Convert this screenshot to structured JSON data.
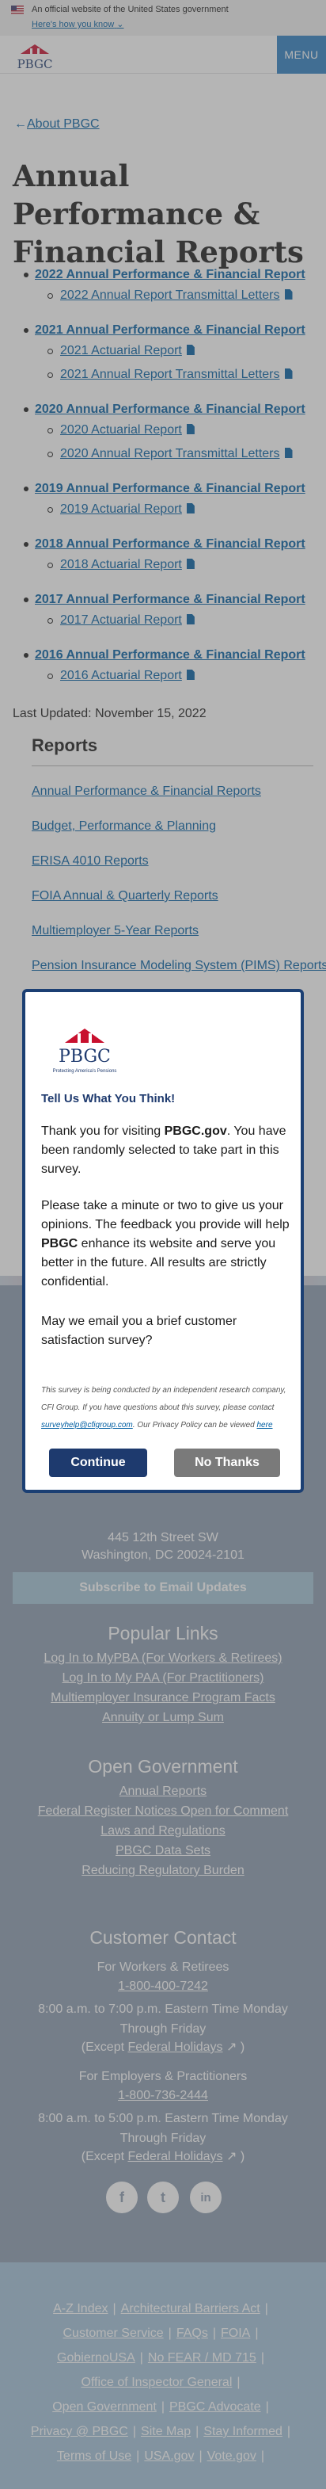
{
  "gov_banner": {
    "text": "An official website of the United States government",
    "link": "Here's how you know"
  },
  "header": {
    "logo_text": "PBGC",
    "menu_label": "MENU"
  },
  "main": {
    "back_link": "About PBGC",
    "title": "Annual Performance & Financial Reports",
    "reports": [
      {
        "label": "2022 Annual Performance & Financial Report",
        "children": [
          "2022 Annual Report Transmittal Letters"
        ]
      },
      {
        "label": "2021 Annual Performance & Financial Report",
        "children": [
          "2021 Actuarial Report",
          "2021 Annual Report Transmittal Letters"
        ]
      },
      {
        "label": "2020 Annual Performance & Financial Report",
        "children": [
          "2020 Actuarial Report",
          "2020 Annual Report Transmittal Letters"
        ]
      },
      {
        "label": "2019 Annual Performance & Financial Report",
        "children": [
          "2019 Actuarial Report"
        ]
      },
      {
        "label": "2018 Annual Performance & Financial Report",
        "children": [
          "2018 Actuarial Report"
        ]
      },
      {
        "label": "2017 Annual Performance & Financial Report",
        "children": [
          "2017 Actuarial Report"
        ]
      },
      {
        "label": "2016 Annual Performance & Financial Report",
        "children": [
          "2016 Actuarial Report"
        ]
      }
    ],
    "last_updated": "Last Updated: November 15, 2022"
  },
  "sidenav": {
    "title": "Reports",
    "items": [
      "Annual Performance & Financial Reports",
      "Budget, Performance & Planning",
      "ERISA 4010 Reports",
      "FOIA Annual & Quarterly Reports",
      "Multiemployer 5-Year Reports",
      "Pension Insurance Modeling System (PIMS) Reports"
    ]
  },
  "survey": {
    "logo_text": "PBGC",
    "logo_tagline": "Protecting America's Pensions",
    "title": "Tell Us What You Think!",
    "p1_pre": "Thank you for visiting ",
    "p1_bold": "PBGC.gov",
    "p1_post": ". You have been randomly selected to take part in this survey.",
    "p2_pre": "Please take a minute or two to give us your opinions. The feedback you provide will help ",
    "p2_bold": "PBGC",
    "p2_post": " enhance its website and serve you better in the future. All results are strictly confidential.",
    "p3": "May we email you a brief customer satisfaction survey?",
    "fine_pre": "This survey is being conducted by an independent research company, CFI Group. If you have questions about this survey, please contact ",
    "fine_email": "surveyhelp@cfigroup.com",
    "fine_mid": ". Our Privacy Policy can be viewed ",
    "fine_here": "here",
    "continue": "Continue",
    "no_thanks": "No Thanks"
  },
  "footer": {
    "address1": "445 12th Street SW",
    "address2": "Washington, DC 20024-2101",
    "subscribe": "Subscribe to Email Updates",
    "popular_title": "Popular Links",
    "popular_links": [
      "Log In to MyPBA (For Workers & Retirees)",
      "Log In to My PAA (For Practitioners)",
      "Multiemployer Insurance Program Facts",
      "Annuity or Lump Sum"
    ],
    "open_gov_title": "Open Government",
    "open_gov_links": [
      "Annual Reports",
      "Federal Register Notices Open for Comment",
      "Laws and Regulations",
      "PBGC Data Sets",
      "Reducing Regulatory Burden"
    ],
    "contact_title": "Customer Contact",
    "workers_label": "For Workers & Retirees",
    "workers_phone": "1-800-400-7242",
    "workers_hours": "8:00 a.m. to 7:00 p.m. Eastern Time Monday Through Friday",
    "except_pre": "(Except ",
    "holidays": "Federal Holidays",
    "except_post": " )",
    "employers_label": "For Employers & Practitioners",
    "employers_phone": "1-800-736-2444",
    "employers_hours": "8:00 a.m. to 5:00 p.m. Eastern Time Monday Through Friday",
    "social": [
      "f",
      "t",
      "in"
    ]
  },
  "footer_bottom": {
    "rows": [
      [
        "A-Z Index",
        "Architectural Barriers Act"
      ],
      [
        "Customer Service",
        "FAQs",
        "FOIA"
      ],
      [
        "GobiernoUSA",
        "No FEAR / MD 715"
      ],
      [
        "Office of Inspector General"
      ],
      [
        "Open Government",
        "PBGC Advocate"
      ],
      [
        "Privacy @ PBGC",
        "Site Map",
        "Stay Informed"
      ],
      [
        "Terms of Use",
        "USA.gov",
        "Vote.gov"
      ]
    ]
  },
  "colors": {
    "link": "#005ea2",
    "menu": "#2d7fc1",
    "footer": "#8a9bb0",
    "modal_border": "#1e3a6e"
  }
}
